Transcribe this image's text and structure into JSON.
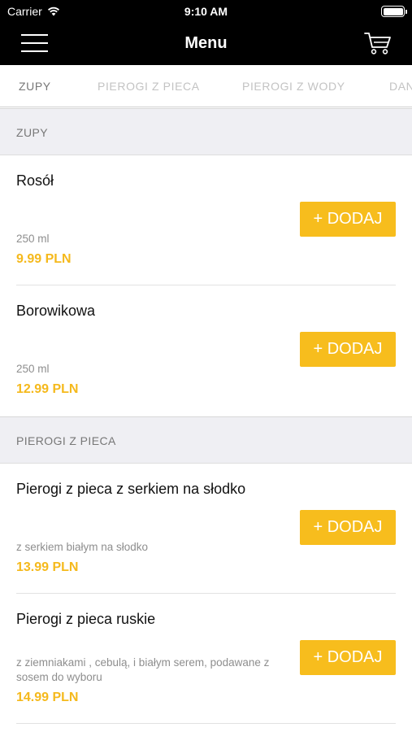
{
  "status_bar": {
    "carrier": "Carrier",
    "time": "9:10 AM"
  },
  "nav": {
    "title": "Menu"
  },
  "tabs": [
    {
      "label": "ZUPY",
      "active": true
    },
    {
      "label": "PIEROGI Z PIECA",
      "active": false
    },
    {
      "label": "PIEROGI Z WODY",
      "active": false
    },
    {
      "label": "DANIA",
      "active": false
    }
  ],
  "sections": [
    {
      "title": "ZUPY",
      "items": [
        {
          "name": "Rosół",
          "description": "250 ml",
          "price": "9.99 PLN",
          "button": "+ DODAJ"
        },
        {
          "name": "Borowikowa",
          "description": "250 ml",
          "price": "12.99 PLN",
          "button": "+ DODAJ"
        }
      ]
    },
    {
      "title": "PIEROGI Z PIECA",
      "items": [
        {
          "name": "Pierogi z pieca z serkiem na słodko",
          "description": "z serkiem białym na słodko",
          "price": "13.99 PLN",
          "button": "+ DODAJ"
        },
        {
          "name": "Pierogi z pieca ruskie",
          "description": "z ziemniakami , cebulą, i białym serem, podawane z sosem do wyboru",
          "price": "14.99 PLN",
          "button": "+ DODAJ"
        }
      ]
    }
  ],
  "colors": {
    "accent": "#f7bd1d",
    "price": "#f5b91c",
    "header_bg": "#000000",
    "section_bg": "#efeff3"
  }
}
